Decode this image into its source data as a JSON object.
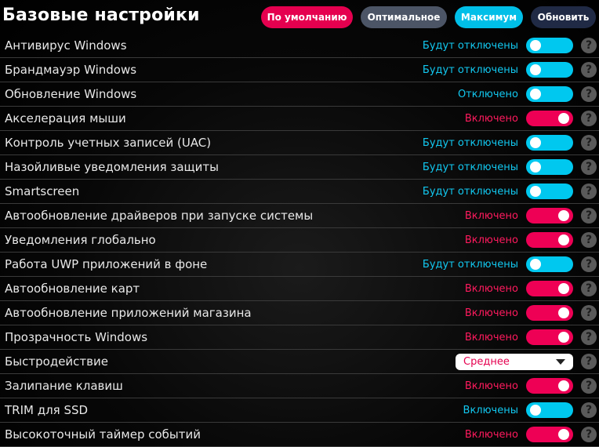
{
  "header": {
    "title": "Базовые настройки",
    "presets": {
      "default_label": "По умолчанию",
      "optimal_label": "Оптимальное",
      "maximum_label": "Максимум",
      "update_label": "Обновить"
    }
  },
  "settings": {
    "help_glyph": "?",
    "rows": [
      {
        "label": "Антивирус Windows",
        "status": "Будут отключены",
        "toggle_on": false
      },
      {
        "label": "Брандмауэр Windows",
        "status": "Будут отключены",
        "toggle_on": false
      },
      {
        "label": "Обновление Windows",
        "status": "Отключено",
        "toggle_on": false
      },
      {
        "label": "Акселерация мыши",
        "status": "Включено",
        "toggle_on": true
      },
      {
        "label": "Контроль учетных записей (UAC)",
        "status": "Будут отключены",
        "toggle_on": false
      },
      {
        "label": "Назойливые уведомления защиты",
        "status": "Будут отключены",
        "toggle_on": false
      },
      {
        "label": "Smartscreen",
        "status": "Будут отключены",
        "toggle_on": false
      },
      {
        "label": "Автообновление драйверов при запуске системы",
        "status": "Включено",
        "toggle_on": true
      },
      {
        "label": "Уведомления глобально",
        "status": "Включено",
        "toggle_on": true
      },
      {
        "label": "Работа UWP приложений в фоне",
        "status": "Будут отключены",
        "toggle_on": false
      },
      {
        "label": "Автообновление карт",
        "status": "Включено",
        "toggle_on": true
      },
      {
        "label": "Автообновление приложений магазина",
        "status": "Включено",
        "toggle_on": true
      },
      {
        "label": "Прозрачность Windows",
        "status": "Включено",
        "toggle_on": true
      },
      {
        "label": "Быстродействие",
        "select_value": "Среднее"
      },
      {
        "label": "Залипание клавиш",
        "status": "Включено",
        "toggle_on": true
      },
      {
        "label": "TRIM для SSD",
        "status": "Включены",
        "toggle_on": false
      },
      {
        "label": "Высокоточный таймер событий",
        "status": "Включено",
        "toggle_on": true
      }
    ]
  },
  "colors": {
    "accent_pink": "#e5004f",
    "accent_cyan": "#00c8ef",
    "status_off_text": "#12c8f0",
    "status_on_text": "#ff1a5e",
    "preset_optimal_bg": "#4c5566",
    "preset_update_bg": "#202a45",
    "background": "#0a0a0a"
  },
  "icons": {
    "help": "question-circle-icon",
    "dropdown": "caret-down-icon"
  }
}
